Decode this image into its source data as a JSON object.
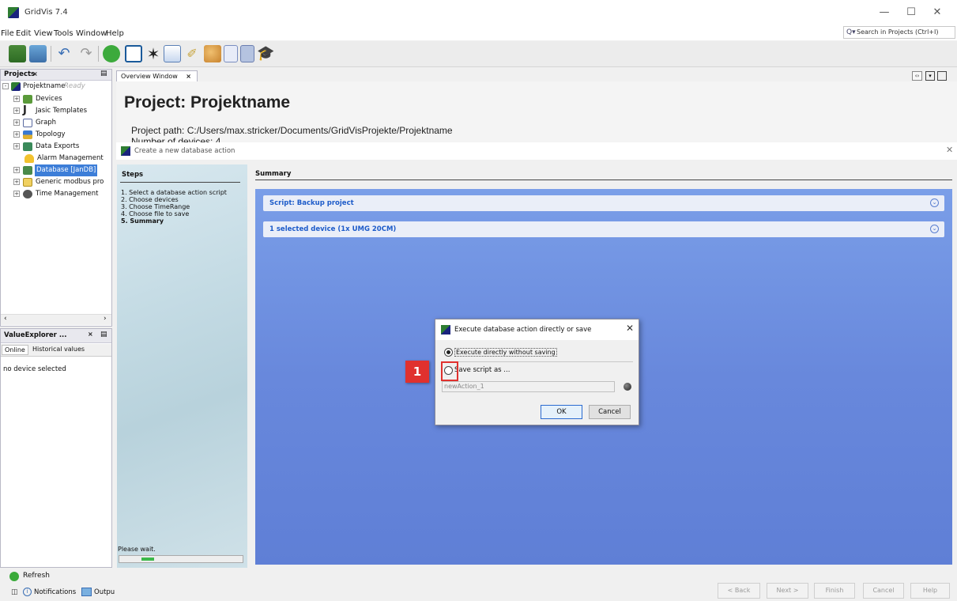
{
  "app": {
    "title": "GridVis 7.4"
  },
  "menu": [
    "File",
    "Edit",
    "View",
    "Tools",
    "Window",
    "Help"
  ],
  "search": {
    "placeholder": "Search in Projects (Ctrl+I)"
  },
  "projects_panel": {
    "tab": "Projects",
    "tree": [
      {
        "label": "Projektname",
        "status": "Ready"
      },
      {
        "label": "Devices"
      },
      {
        "label": "Jasic Templates"
      },
      {
        "label": "Graph"
      },
      {
        "label": "Topology"
      },
      {
        "label": "Data Exports"
      },
      {
        "label": "Alarm Management"
      },
      {
        "label": "Database [JanDB]"
      },
      {
        "label": "Generic modbus pro"
      },
      {
        "label": "Time Management"
      }
    ]
  },
  "value_explorer": {
    "tab": "ValueExplorer ...",
    "subtabs": [
      "Online",
      "Historical values"
    ],
    "empty": "no device selected"
  },
  "bottom": {
    "refresh": "Refresh",
    "notifications": "Notifications",
    "output": "Outpu"
  },
  "overview": {
    "tab": "Overview Window",
    "title": "Project: Projektname",
    "path": "Project path: C:/Users/max.stricker/Documents/GridVisProjekte/Projektname",
    "devices": "Number of devices: 4"
  },
  "wizard": {
    "title": "Create a new database action",
    "steps_header": "Steps",
    "steps": [
      "1.   Select a database action script",
      "2.   Choose devices",
      "3.   Choose TimeRange",
      "4.   Choose file to save",
      "5.   Summary"
    ],
    "summary_header": "Summary",
    "sections": [
      "Script: Backup project",
      "1 selected device (1x UMG 20CM)"
    ],
    "please_wait": "Please wait.",
    "progress": 0.1,
    "buttons": [
      "< Back",
      "Next >",
      "Finish",
      "Cancel",
      "Help"
    ]
  },
  "dialog": {
    "title": "Execute database action directly or save",
    "option1": "Execute directly without saving",
    "option2": "Save script as ...",
    "name_value": "newAction_1",
    "ok": "OK",
    "cancel": "Cancel"
  },
  "callout": {
    "number": "1",
    "color": "#e0312e"
  }
}
